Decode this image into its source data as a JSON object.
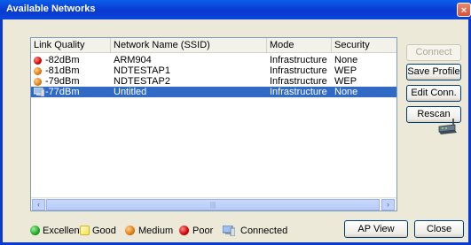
{
  "window": {
    "title": "Available Networks",
    "close_glyph": "×"
  },
  "table": {
    "columns": [
      "Link Quality",
      "Network Name (SSID)",
      "Mode",
      "Security"
    ],
    "rows": [
      {
        "quality": "-82dBm",
        "ssid": "ARM904",
        "mode": "Infrastructure",
        "security": "None",
        "signal": "red",
        "selected": false
      },
      {
        "quality": "-81dBm",
        "ssid": "NDTESTAP1",
        "mode": "Infrastructure",
        "security": "WEP",
        "signal": "orange",
        "selected": false
      },
      {
        "quality": "-79dBm",
        "ssid": "NDTESTAP2",
        "mode": "Infrastructure",
        "security": "WEP",
        "signal": "orange",
        "selected": false
      },
      {
        "quality": "-77dBm",
        "ssid": "Untitled",
        "mode": "Infrastructure",
        "security": "None",
        "signal": "connected",
        "selected": true
      }
    ]
  },
  "scrollbar": {
    "left_glyph": "‹",
    "right_glyph": "›",
    "thumb_grip": "|||"
  },
  "side_buttons": {
    "connect": {
      "label": "Connect",
      "enabled": false
    },
    "save_profile": {
      "label": "Save Profile"
    },
    "edit_conn": {
      "label": "Edit Conn."
    },
    "rescan": {
      "label": "Rescan"
    }
  },
  "legend": {
    "excellent": "Excellent",
    "good": "Good",
    "medium": "Medium",
    "poor": "Poor",
    "connected": "Connected"
  },
  "bottom_buttons": {
    "ap_view": "AP View",
    "close": "Close"
  },
  "icons": {
    "router": "router-icon",
    "connected": "connected-pc-icon"
  },
  "colors": {
    "selection": "#316ac5",
    "titlebar": "#0a3ad0",
    "red": "#d00000",
    "orange": "#e07a10",
    "green": "#22a322",
    "yellow": "#f5e24a"
  }
}
